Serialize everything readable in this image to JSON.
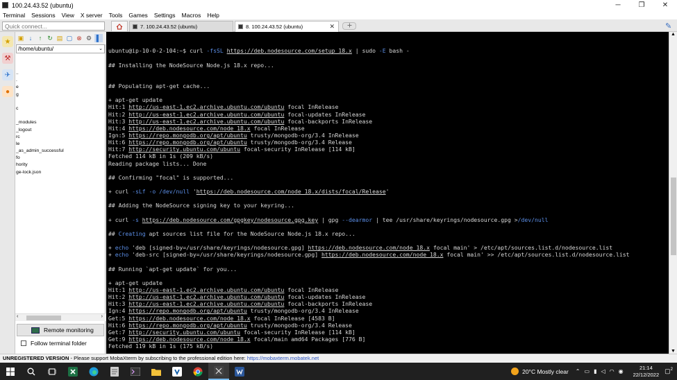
{
  "window": {
    "title": "100.24.43.52 (ubuntu)",
    "min": "─",
    "max": "❐",
    "close": "✕"
  },
  "menu": [
    "Terminal",
    "Sessions",
    "View",
    "X server",
    "Tools",
    "Games",
    "Settings",
    "Macros",
    "Help"
  ],
  "quick_connect": {
    "placeholder": "Quick connect..."
  },
  "tabs": [
    {
      "label": "7. 100.24.43.52 (ubuntu)",
      "active": false
    },
    {
      "label": "8. 100.24.43.52 (ubuntu)",
      "active": true,
      "close": "✕"
    }
  ],
  "sidebar": {
    "path": "/home/ubuntu/",
    "files": [
      "..",
      ".",
      "e",
      "g",
      "",
      "c",
      "",
      "_modules",
      "_logout",
      "rc",
      "le",
      "_as_admin_successful",
      "fo",
      "hority",
      "ge-lock.json"
    ],
    "remote_monitoring": "Remote monitoring",
    "follow_terminal": "Follow terminal folder"
  },
  "terminal": {
    "prompt": "ubuntu@ip-10-0-2-104:~$ ",
    "cmd_pre": "curl ",
    "cmd_flag": "-fsSL",
    "cmd_url": "https://deb.nodesource.com/setup_18.x",
    "cmd_mid": " | sudo ",
    "cmd_flag2": "-E",
    "cmd_post": " bash -",
    "l_installing": "## Installing the NodeSource Node.js 18.x repo...",
    "l_populating": "## Populating apt-get cache...",
    "l_aptupdate": "+ apt-get update",
    "block1": [
      {
        "pre": "Hit:1 ",
        "url": "http://us-east-1.ec2.archive.ubuntu.com/ubuntu",
        "post": " focal InRelease"
      },
      {
        "pre": "Hit:2 ",
        "url": "http://us-east-1.ec2.archive.ubuntu.com/ubuntu",
        "post": " focal-updates InRelease"
      },
      {
        "pre": "Hit:3 ",
        "url": "http://us-east-1.ec2.archive.ubuntu.com/ubuntu",
        "post": " focal-backports InRelease"
      },
      {
        "pre": "Hit:4 ",
        "url": "https://deb.nodesource.com/node_18.x",
        "post": " focal InRelease"
      },
      {
        "pre": "Ign:5 ",
        "url": "https://repo.mongodb.org/apt/ubuntu",
        "post": " trusty/mongodb-org/3.4 InRelease"
      },
      {
        "pre": "Hit:6 ",
        "url": "https://repo.mongodb.org/apt/ubuntu",
        "post": " trusty/mongodb-org/3.4 Release"
      },
      {
        "pre": "Hit:7 ",
        "url": "http://security.ubuntu.com/ubuntu",
        "post": " focal-security InRelease [114 kB]"
      }
    ],
    "l_fetched1": "Fetched 114 kB in 1s (209 kB/s)",
    "l_reading": "Reading package lists... Done",
    "l_confirming": "## Confirming \"focal\" is supported...",
    "curl1_pre": "+ curl ",
    "curl1_flag": "-sLf -o /dev/null",
    "curl1_q": " '",
    "curl1_url": "https://deb.nodesource.com/node_18.x/dists/focal/Release",
    "curl1_end": "'",
    "l_adding": "## Adding the NodeSource signing key to your keyring...",
    "curl2_pre": "+ curl ",
    "curl2_flag": "-s",
    "curl2_sp": " ",
    "curl2_url": "https://deb.nodesource.com/gpgkey/nodesource.gpg.key",
    "curl2_mid": " | gpg ",
    "curl2_flag2": "--dearmor",
    "curl2_mid2": " | tee /usr/share/keyrings/nodesource.gpg >",
    "curl2_devnull": "/dev/null",
    "creating_hash": "## ",
    "creating_word": "Creating",
    "creating_rest": " apt sources list file for the NodeSource Node.js 18.x repo...",
    "echo1_plus": "+ ",
    "echo1_kw": "echo",
    "echo1_pre": " 'deb [signed-by=/usr/share/keyrings/nodesource.gpg] ",
    "echo1_url": "https://deb.nodesource.com/node_18.x",
    "echo1_post": " focal main' > /etc/apt/sources.list.d/nodesource.list",
    "echo2_plus": "+ ",
    "echo2_kw": "echo",
    "echo2_pre": " 'deb-src [signed-by=/usr/share/keyrings/nodesource.gpg] ",
    "echo2_url": "https://deb.nodesource.com/node_18.x",
    "echo2_post": " focal main' >> /etc/apt/sources.list.d/nodesource.list",
    "l_running": "## Running `apt-get update` for you...",
    "l_aptupdate2": "+ apt-get update",
    "block2": [
      {
        "pre": "Hit:1 ",
        "url": "http://us-east-1.ec2.archive.ubuntu.com/ubuntu",
        "post": " focal InRelease"
      },
      {
        "pre": "Hit:2 ",
        "url": "http://us-east-1.ec2.archive.ubuntu.com/ubuntu",
        "post": " focal-updates InRelease"
      },
      {
        "pre": "Hit:3 ",
        "url": "http://us-east-1.ec2.archive.ubuntu.com/ubuntu",
        "post": " focal-backports InRelease"
      },
      {
        "pre": "Ign:4 ",
        "url": "https://repo.mongodb.org/apt/ubuntu",
        "post": " trusty/mongodb-org/3.4 InRelease"
      },
      {
        "pre": "Get:5 ",
        "url": "https://deb.nodesource.com/node_18.x",
        "post": " focal InRelease [4583 B]"
      },
      {
        "pre": "Hit:6 ",
        "url": "https://repo.mongodb.org/apt/ubuntu",
        "post": " trusty/mongodb-org/3.4 Release"
      },
      {
        "pre": "Get:7 ",
        "url": "http://security.ubuntu.com/ubuntu",
        "post": " focal-security InRelease [114 kB]"
      },
      {
        "pre": "Get:9 ",
        "url": "https://deb.nodesource.com/node_18.x",
        "post": " focal/main amd64 Packages [776 B]"
      }
    ],
    "l_fetched2": "Fetched 119 kB in 1s (175 kB/s)"
  },
  "status": {
    "unregistered": "UNREGISTERED VERSION",
    "message": "  -  Please support MobaXterm by subscribing to the professional edition here:  ",
    "link": "https://mobaxterm.mobatek.net"
  },
  "taskbar": {
    "weather": "20°C  Mostly clear",
    "time": "21:14",
    "date": "22/12/2022",
    "notifications": "2"
  },
  "colors": {
    "link_blue": "#5b8ee6",
    "terminal_bg": "#000000",
    "terminal_fg": "#d8d8d8"
  }
}
